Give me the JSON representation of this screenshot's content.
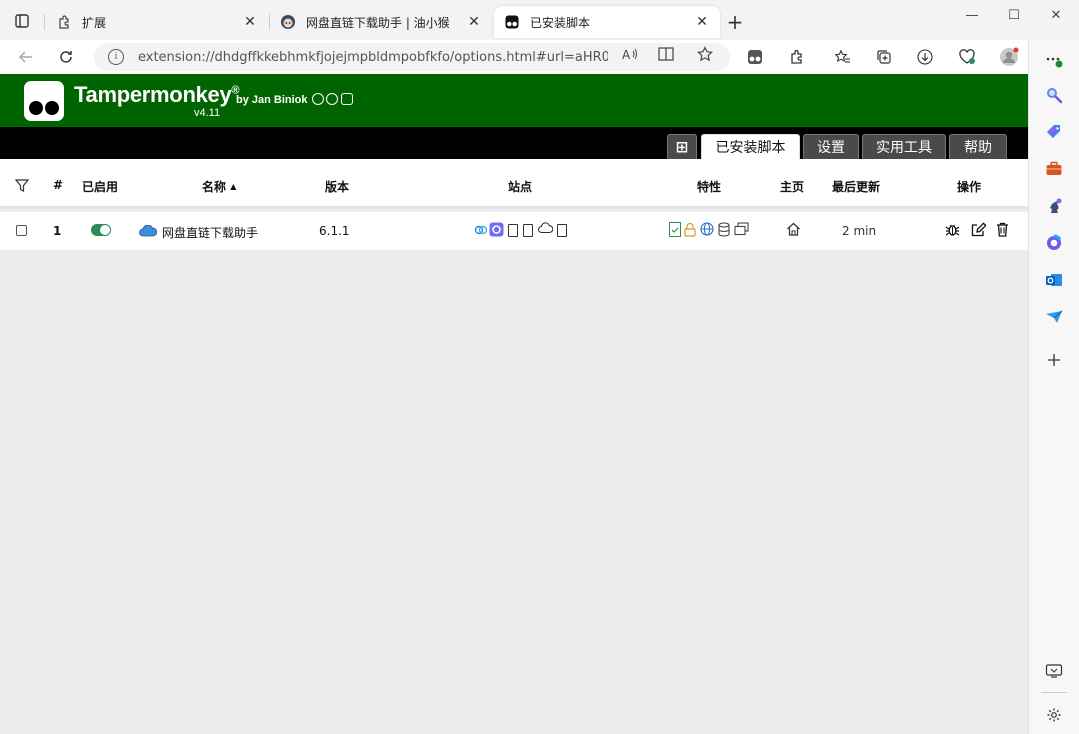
{
  "browser": {
    "tabs": [
      {
        "title": "扩展",
        "icon": "extensions-icon",
        "active": false
      },
      {
        "title": "网盘直链下载助手 | 油小猴",
        "icon": "site-avatar-icon",
        "active": false
      },
      {
        "title": "已安装脚本",
        "icon": "tampermonkey-icon",
        "active": true
      }
    ],
    "tab_close_glyph": "✕",
    "new_tab_glyph": "+",
    "window_controls": {
      "minimize": "—",
      "maximize": "☐",
      "close": "✕"
    },
    "address_url": "extension://dhdgffkkebhmkfjojejmpbldmpobfkfo/options.html#url=aHR0cHM6..."
  },
  "tampermonkey": {
    "title": "Tampermonkey",
    "registered": "®",
    "author": "by Jan Biniok",
    "version": "v4.11",
    "tabs": {
      "add": "⊞",
      "installed": "已安装脚本",
      "settings": "设置",
      "utilities": "实用工具",
      "help": "帮助"
    },
    "columns": {
      "filter": "filter-icon",
      "num": "#",
      "enabled": "已启用",
      "name": "名称",
      "sort_indicator": "▲",
      "version": "版本",
      "sites": "站点",
      "features": "特性",
      "homepage": "主页",
      "last_updated": "最后更新",
      "actions": "操作"
    },
    "scripts": [
      {
        "index": "1",
        "enabled": true,
        "name": "网盘直链下载助手",
        "version": "6.1.1",
        "last_updated": "2 min"
      }
    ]
  },
  "colors": {
    "header_green": "#006400",
    "toggle_on": "#2e8b57",
    "tab_bar": "#000000"
  }
}
